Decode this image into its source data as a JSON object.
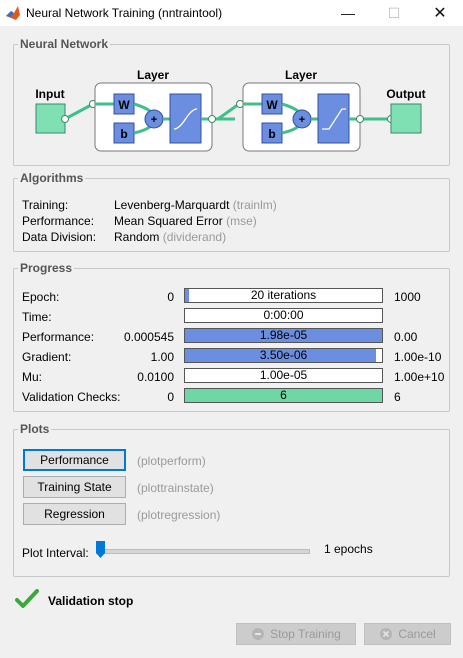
{
  "window": {
    "title": "Neural Network Training (nntraintool)"
  },
  "network": {
    "group_label": "Neural Network",
    "input_label": "Input",
    "output_label": "Output",
    "layer1_label": "Layer",
    "layer2_label": "Layer",
    "weight_label": "W",
    "bias_label": "b",
    "sum_symbol": "+"
  },
  "algorithms": {
    "group_label": "Algorithms",
    "rows": [
      {
        "label": "Training:",
        "value": "Levenberg-Marquardt",
        "hint": "(trainlm)"
      },
      {
        "label": "Performance:",
        "value": "Mean Squared Error",
        "hint": "(mse)"
      },
      {
        "label": "Data Division:",
        "value": "Random",
        "hint": "(dividerand)"
      }
    ]
  },
  "progress": {
    "group_label": "Progress",
    "rows": [
      {
        "label": "Epoch:",
        "start": "0",
        "bar_text": "20 iterations",
        "end": "1000",
        "fill_fraction": 0.02,
        "fill_color": "#6b8ee0"
      },
      {
        "label": "Time:",
        "start": "",
        "bar_text": "0:00:00",
        "end": "",
        "fill_fraction": 0,
        "fill_color": "#6b8ee0"
      },
      {
        "label": "Performance:",
        "start": "0.000545",
        "bar_text": "1.98e-05",
        "end": "0.00",
        "fill_fraction": 1.0,
        "fill_color": "#6b8ee0"
      },
      {
        "label": "Gradient:",
        "start": "1.00",
        "bar_text": "3.50e-06",
        "end": "1.00e-10",
        "fill_fraction": 0.97,
        "fill_color": "#6b8ee0"
      },
      {
        "label": "Mu:",
        "start": "0.0100",
        "bar_text": "1.00e-05",
        "end": "1.00e+10",
        "fill_fraction": 0,
        "fill_color": "#6b8ee0"
      },
      {
        "label": "Validation Checks:",
        "start": "0",
        "bar_text": "6",
        "end": "6",
        "fill_fraction": 1.0,
        "fill_color": "#6fd7a3"
      }
    ]
  },
  "plots": {
    "group_label": "Plots",
    "buttons": [
      {
        "label": "Performance",
        "hint": "(plotperform)"
      },
      {
        "label": "Training State",
        "hint": "(plottrainstate)"
      },
      {
        "label": "Regression",
        "hint": "(plotregression)"
      }
    ],
    "interval_label": "Plot Interval:",
    "interval_value": "1 epochs",
    "slider_fraction": 0
  },
  "status": {
    "text": "Validation stop",
    "icon": "check-icon",
    "color": "#3aa83a"
  },
  "actions": {
    "stop_label": "Stop Training",
    "cancel_label": "Cancel"
  },
  "colors": {
    "input_box": "#7fe0b4",
    "layer_box": "#6b8ee0",
    "connector": "#3fc08a"
  }
}
